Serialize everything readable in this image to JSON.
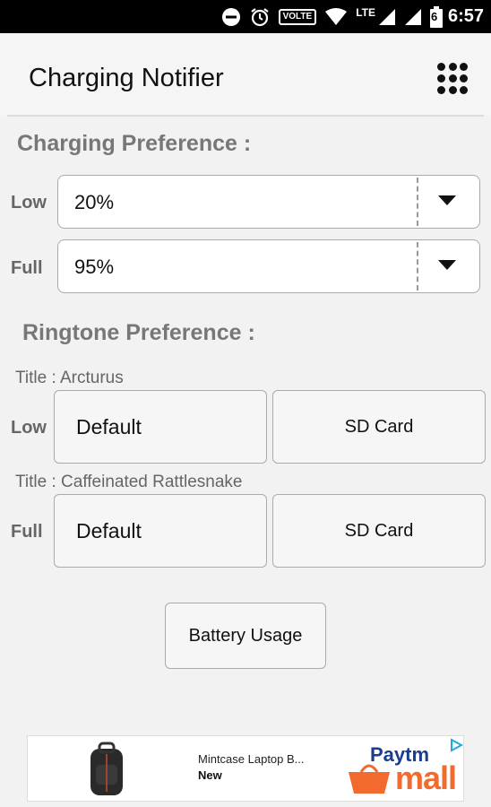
{
  "status_bar": {
    "network": "VOLTE",
    "lte": "LTE",
    "battery": "6",
    "time": "6:57"
  },
  "app": {
    "title": "Charging Notifier"
  },
  "charging_preference": {
    "heading": "Charging Preference :",
    "low_label": "Low",
    "low_value": "20%",
    "full_label": "Full",
    "full_value": "95%"
  },
  "ringtone_preference": {
    "heading": "Ringtone Preference :",
    "low_title": "Title : Arcturus",
    "low_label": "Low",
    "full_title": "Title : Caffeinated Rattlesnake",
    "full_label": "Full",
    "default_label": "Default",
    "sdcard_label": "SD Card"
  },
  "actions": {
    "battery_usage": "Battery Usage"
  },
  "ad": {
    "product_name": "Mintcase Laptop B...",
    "product_tag": "New",
    "brand_top": "Paytm",
    "brand_bottom": "mall",
    "colors": {
      "paytm_blue": "#1a3e8c",
      "mall_orange": "#f26a2e",
      "adchoices": "#22a7e0"
    }
  }
}
